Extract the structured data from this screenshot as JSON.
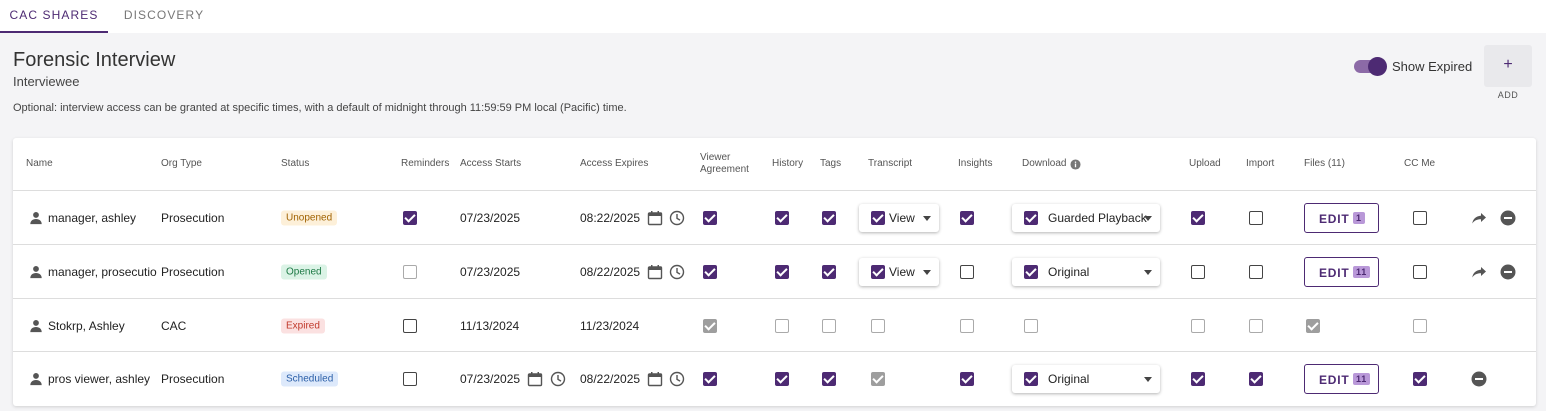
{
  "tabs": [
    {
      "label": "CAC SHARES",
      "active": true
    },
    {
      "label": "DISCOVERY",
      "active": false
    }
  ],
  "header": {
    "title": "Forensic Interview",
    "subtitle": "Interviewee",
    "note": "Optional: interview access can be granted at specific times, with a default of midnight through 11:59:59 PM local (Pacific) time.",
    "show_expired_label": "Show Expired",
    "show_expired_on": true,
    "add_icon": "+",
    "add_label": "ADD"
  },
  "colors": {
    "accent": "#4d2a73",
    "badge_count": "#b998d8"
  },
  "columns": {
    "name": "Name",
    "org_type": "Org Type",
    "status": "Status",
    "reminders": "Reminders",
    "access_starts": "Access Starts",
    "access_expires": "Access Expires",
    "viewer_agreement_1": "Viewer",
    "viewer_agreement_2": "Agreement",
    "history": "History",
    "tags": "Tags",
    "transcript": "Transcript",
    "insights": "Insights",
    "download": "Download",
    "upload": "Upload",
    "import": "Import",
    "files": "Files (11)",
    "cc_me": "CC Me"
  },
  "rows": [
    {
      "name": "manager, ashley",
      "org_type": "Prosecution",
      "status": "Unopened",
      "starts": "07/23/2025",
      "expires": "08:22/2025",
      "transcript_label": "View",
      "download_label": "Guarded Playback",
      "edit_label": "EDIT",
      "file_count": "1"
    },
    {
      "name": "manager, prosecutio",
      "org_type": "Prosecution",
      "status": "Opened",
      "starts": "07/23/2025",
      "expires": "08/22/2025",
      "transcript_label": "View",
      "download_label": "Original",
      "edit_label": "EDIT",
      "file_count": "11"
    },
    {
      "name": "Stokrp, Ashley",
      "org_type": "CAC",
      "status": "Expired",
      "starts": "11/13/2024",
      "expires": "11/23/2024"
    },
    {
      "name": "pros viewer, ashley",
      "org_type": "Prosecution",
      "status": "Scheduled",
      "starts": "07/23/2025",
      "expires": "08/22/2025",
      "download_label": "Original",
      "edit_label": "EDIT",
      "file_count": "11"
    }
  ]
}
